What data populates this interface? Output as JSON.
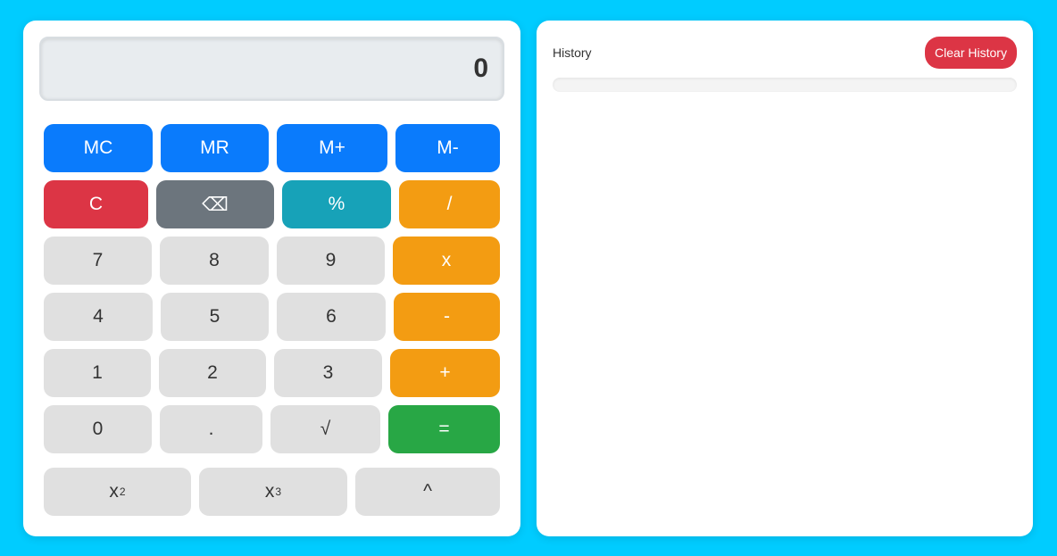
{
  "calculator": {
    "display_value": "0",
    "memory": {
      "mc": "MC",
      "mr": "MR",
      "mplus": "M+",
      "mminus": "M-"
    },
    "controls": {
      "clear": "C",
      "backspace": "⌫",
      "percent": "%",
      "divide": "/"
    },
    "keys": {
      "seven": "7",
      "eight": "8",
      "nine": "9",
      "multiply": "x",
      "four": "4",
      "five": "5",
      "six": "6",
      "minus": "-",
      "one": "1",
      "two": "2",
      "three": "3",
      "plus": "+",
      "zero": "0",
      "dot": ".",
      "sqrt": "√",
      "equals": "="
    },
    "powers": {
      "square_base": "x",
      "square_exp": "2",
      "cube_base": "x",
      "cube_exp": "3",
      "power": "^"
    }
  },
  "history": {
    "title": "History",
    "clear_label": "Clear History"
  },
  "colors": {
    "background": "#00ccff",
    "memory_button": "#0a7bfc",
    "clear_button": "#dc3545",
    "backspace_button": "#6c757d",
    "percent_button": "#17a2b8",
    "operator_button": "#f39c12",
    "equals_button": "#28a745",
    "number_button": "#e0e0e0"
  }
}
